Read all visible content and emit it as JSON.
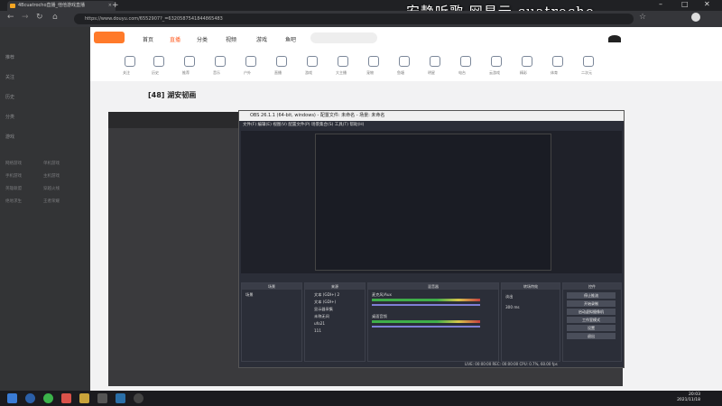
{
  "overlay": {
    "text": "安静听歌 网易云 cuatrocho"
  },
  "browser": {
    "tab_title": "4Bcuatrocho直播_他他游戏直播",
    "url": "https://www.douyu.com/6552907?_=6320587541844865483",
    "new_tab": "+"
  },
  "site": {
    "nav": [
      "首页",
      "直播",
      "分类",
      "视频",
      "游戏",
      "鱼吧"
    ],
    "icons": [
      "关注",
      "历史",
      "推荐",
      "音乐",
      "户外",
      "直播",
      "游戏",
      "大主播",
      "宠物",
      "鱼塘",
      "明星",
      "电台",
      "云游戏",
      "精彩",
      "体育",
      "二次元"
    ],
    "room_title": "[48] 湖安韧画"
  },
  "sidebar": {
    "items": [
      "推荐",
      "关注",
      "历史",
      "分类",
      "游戏"
    ],
    "grid": [
      "网络游戏",
      "单机游戏",
      "手机游戏",
      "主机游戏",
      "英雄联盟",
      "穿越火线",
      "绝地求生",
      "王者荣耀"
    ]
  },
  "obs": {
    "title": "OBS 26.1.1 (64-bit, windows) - 配置文件: 未命名 - 场景: 未命名",
    "menu": "文件(F)  编辑(E)  视图(V)  配置文件(P)  场景集合(S)  工具(T)  帮助(H)",
    "scene_panel": "场景",
    "source_panel": "来源",
    "mixer_panel": "混音器",
    "transition_panel": "转场特效",
    "controls_panel": "控件",
    "scene_item": "场景",
    "sources": [
      "文本 (GDI+) 2",
      "文本 (GDI+)",
      "显示器采集",
      "未称无间",
      "ufo21",
      "111"
    ],
    "mixer": [
      "麦克风/Aux",
      "桌面音频"
    ],
    "transition": "淡出",
    "duration": "300 ms",
    "controls": [
      "停止推流",
      "开始录制",
      "启动虚拟摄像机",
      "工作室模式",
      "设置",
      "退出"
    ],
    "status": "LIVE: 00:00:00  REC: 00:00:00  CPU: 0.7%, 60.00 fps"
  },
  "taskbar": {
    "time": "20:03",
    "date": "2021/11/18"
  }
}
